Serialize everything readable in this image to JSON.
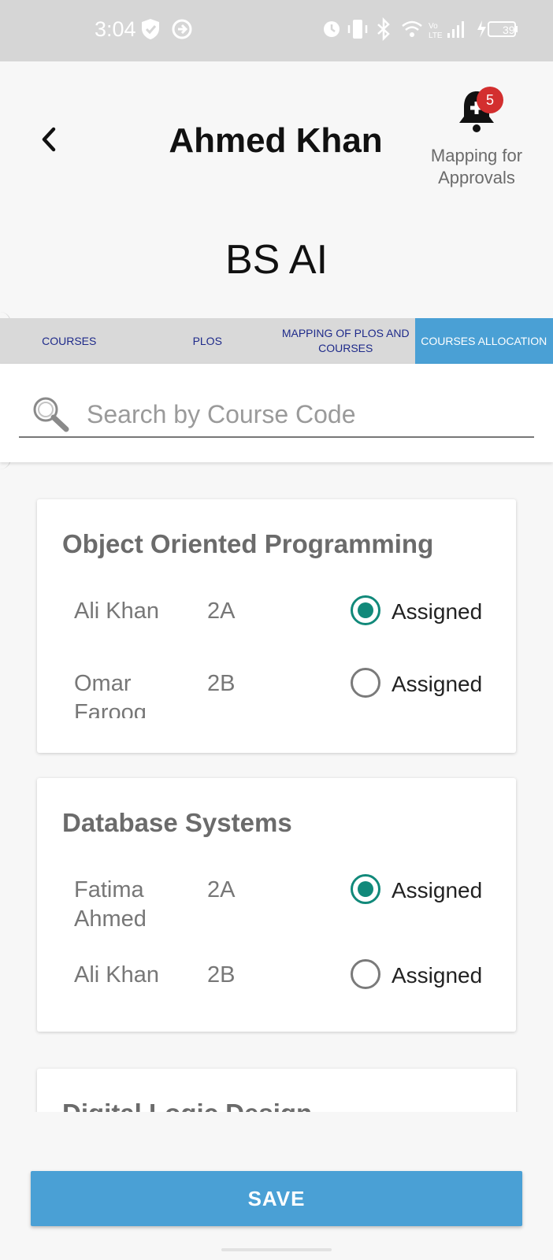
{
  "status_bar": {
    "time": "3:04",
    "battery": "39"
  },
  "header": {
    "title": "Ahmed Khan",
    "notification_count": "5",
    "approvals_label_line1": "Mapping for",
    "approvals_label_line2": "Approvals"
  },
  "program": "BS AI",
  "tabs": [
    {
      "label": "COURSES",
      "active": false
    },
    {
      "label": "PLOS",
      "active": false
    },
    {
      "label": "MAPPING OF PLOS AND COURSES",
      "active": false
    },
    {
      "label": "COURSES ALLOCATION",
      "active": true
    }
  ],
  "search": {
    "placeholder": "Search by Course Code"
  },
  "courses": [
    {
      "title": "Object Oriented Programming",
      "allocations": [
        {
          "teacher": "Ali Khan",
          "section": "2A",
          "status": "Assigned",
          "checked": true
        },
        {
          "teacher": "Omar Farooq",
          "section": "2B",
          "status": "Assigned",
          "checked": false
        }
      ]
    },
    {
      "title": "Database Systems",
      "allocations": [
        {
          "teacher": "Fatima Ahmed",
          "section": "2A",
          "status": "Assigned",
          "checked": true
        },
        {
          "teacher": "Ali Khan",
          "section": "2B",
          "status": "Assigned",
          "checked": false
        }
      ]
    },
    {
      "title": "Digital Logic Design",
      "allocations": []
    }
  ],
  "save_label": "SAVE",
  "colors": {
    "accent": "#4aa0d5",
    "radio_checked": "#11897a",
    "badge": "#d32f2f",
    "tab_text": "#1e2a8a"
  }
}
